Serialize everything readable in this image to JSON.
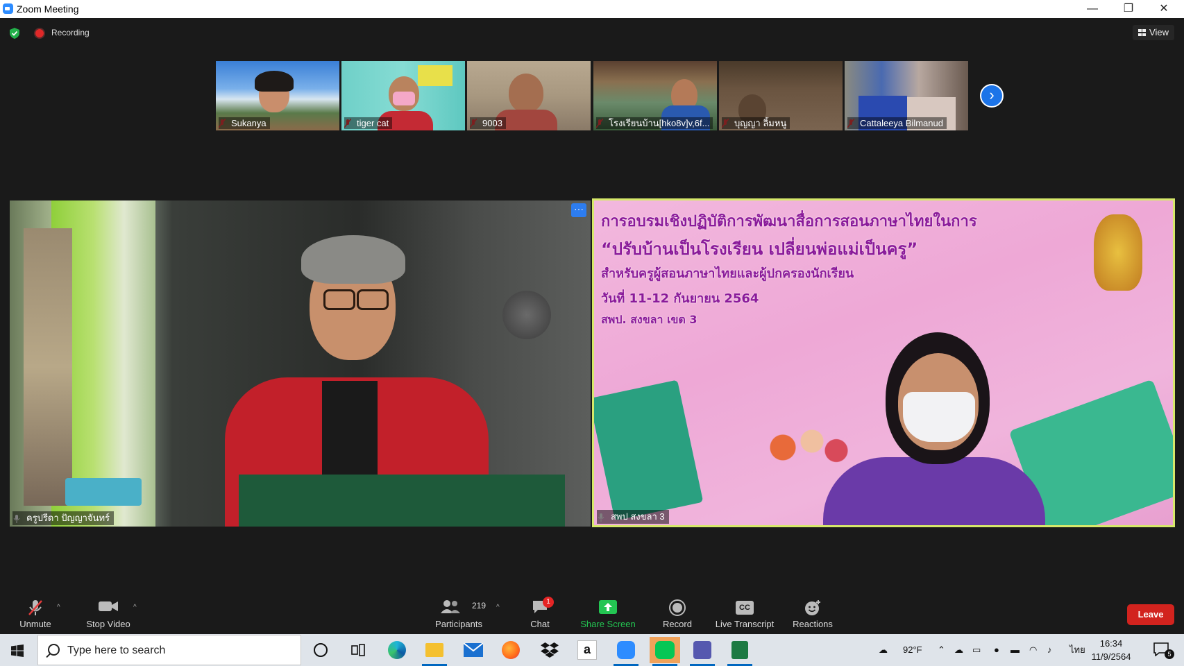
{
  "window": {
    "title": "Zoom Meeting",
    "minimize": "—",
    "restore": "❐",
    "close": "✕"
  },
  "status": {
    "recording_label": "Recording",
    "view_label": "View"
  },
  "thumbnails": [
    {
      "name": "Sukanya"
    },
    {
      "name": "tiger cat"
    },
    {
      "name": "9003"
    },
    {
      "name": "โรงเรียนบ้าน[hko8v]v,6f..."
    },
    {
      "name": "บุญญา ลิ้มหนู"
    },
    {
      "name": "Cattaleeya Bilmanud"
    }
  ],
  "next_arrow": "›",
  "main_videos": {
    "left": {
      "name": "ครูปรีดา ปัญญาจันทร์",
      "more": "···"
    },
    "right": {
      "name": "สพป สงขลา 3"
    }
  },
  "slide": {
    "line1": "การอบรมเชิงปฏิบัติการพัฒนาสื่อการสอนภาษาไทยในการ",
    "line2": "“ปรับบ้านเป็นโรงเรียน เปลี่ยนพ่อแม่เป็นครู”",
    "line3": "สำหรับครูผู้สอนภาษาไทยและผู้ปกครองนักเรียน",
    "line4": "วันที่ 11-12 กันยายน 2564",
    "line5": "สพป. สงขลา เขต 3"
  },
  "toolbar": {
    "unmute": "Unmute",
    "stop_video": "Stop Video",
    "participants": "Participants",
    "participants_count": "219",
    "chat": "Chat",
    "chat_badge": "1",
    "share_screen": "Share Screen",
    "record": "Record",
    "live_transcript": "Live Transcript",
    "cc": "CC",
    "reactions": "Reactions",
    "leave": "Leave",
    "caret": "^"
  },
  "taskbar": {
    "search_placeholder": "Type here to search",
    "temperature": "92°F",
    "language": "ไทย",
    "time": "16:34",
    "date": "11/9/2564",
    "notif_count": "5"
  },
  "colors": {
    "accent_blue": "#2d8cff",
    "leave_red": "#d2231e",
    "share_green": "#23c552",
    "active_speaker_border": "#d6e86a"
  }
}
